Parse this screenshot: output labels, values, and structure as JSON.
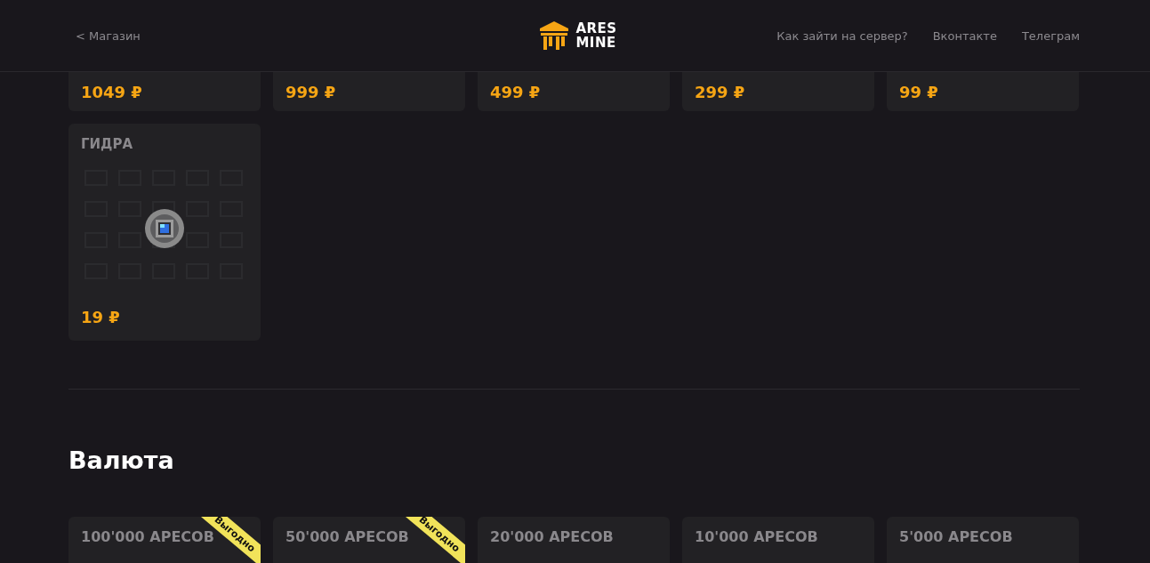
{
  "header": {
    "back_link": "< Магазин",
    "logo": [
      "ARES",
      "MINE"
    ],
    "nav": [
      "Как зайти на сервер?",
      "Вконтакте",
      "Телеграм"
    ]
  },
  "privileges": [
    {
      "price": "1049 ₽",
      "cut": true
    },
    {
      "price": "999 ₽",
      "cut": true
    },
    {
      "price": "499 ₽",
      "cut": true
    },
    {
      "price": "299 ₽",
      "cut": true
    },
    {
      "price": "99 ₽",
      "cut": true
    },
    {
      "name": "ГИДРА",
      "price": "19 ₽",
      "cut": false
    }
  ],
  "currency": {
    "title": "Валюта",
    "items": [
      {
        "name": "100'000 АРЕСОВ",
        "badge": "Выгодно"
      },
      {
        "name": "50'000 АРЕСОВ",
        "badge": "Выгодно"
      },
      {
        "name": "20'000 АРЕСОВ"
      },
      {
        "name": "10'000 АРЕСОВ"
      },
      {
        "name": "5'000 АРЕСОВ"
      }
    ]
  }
}
